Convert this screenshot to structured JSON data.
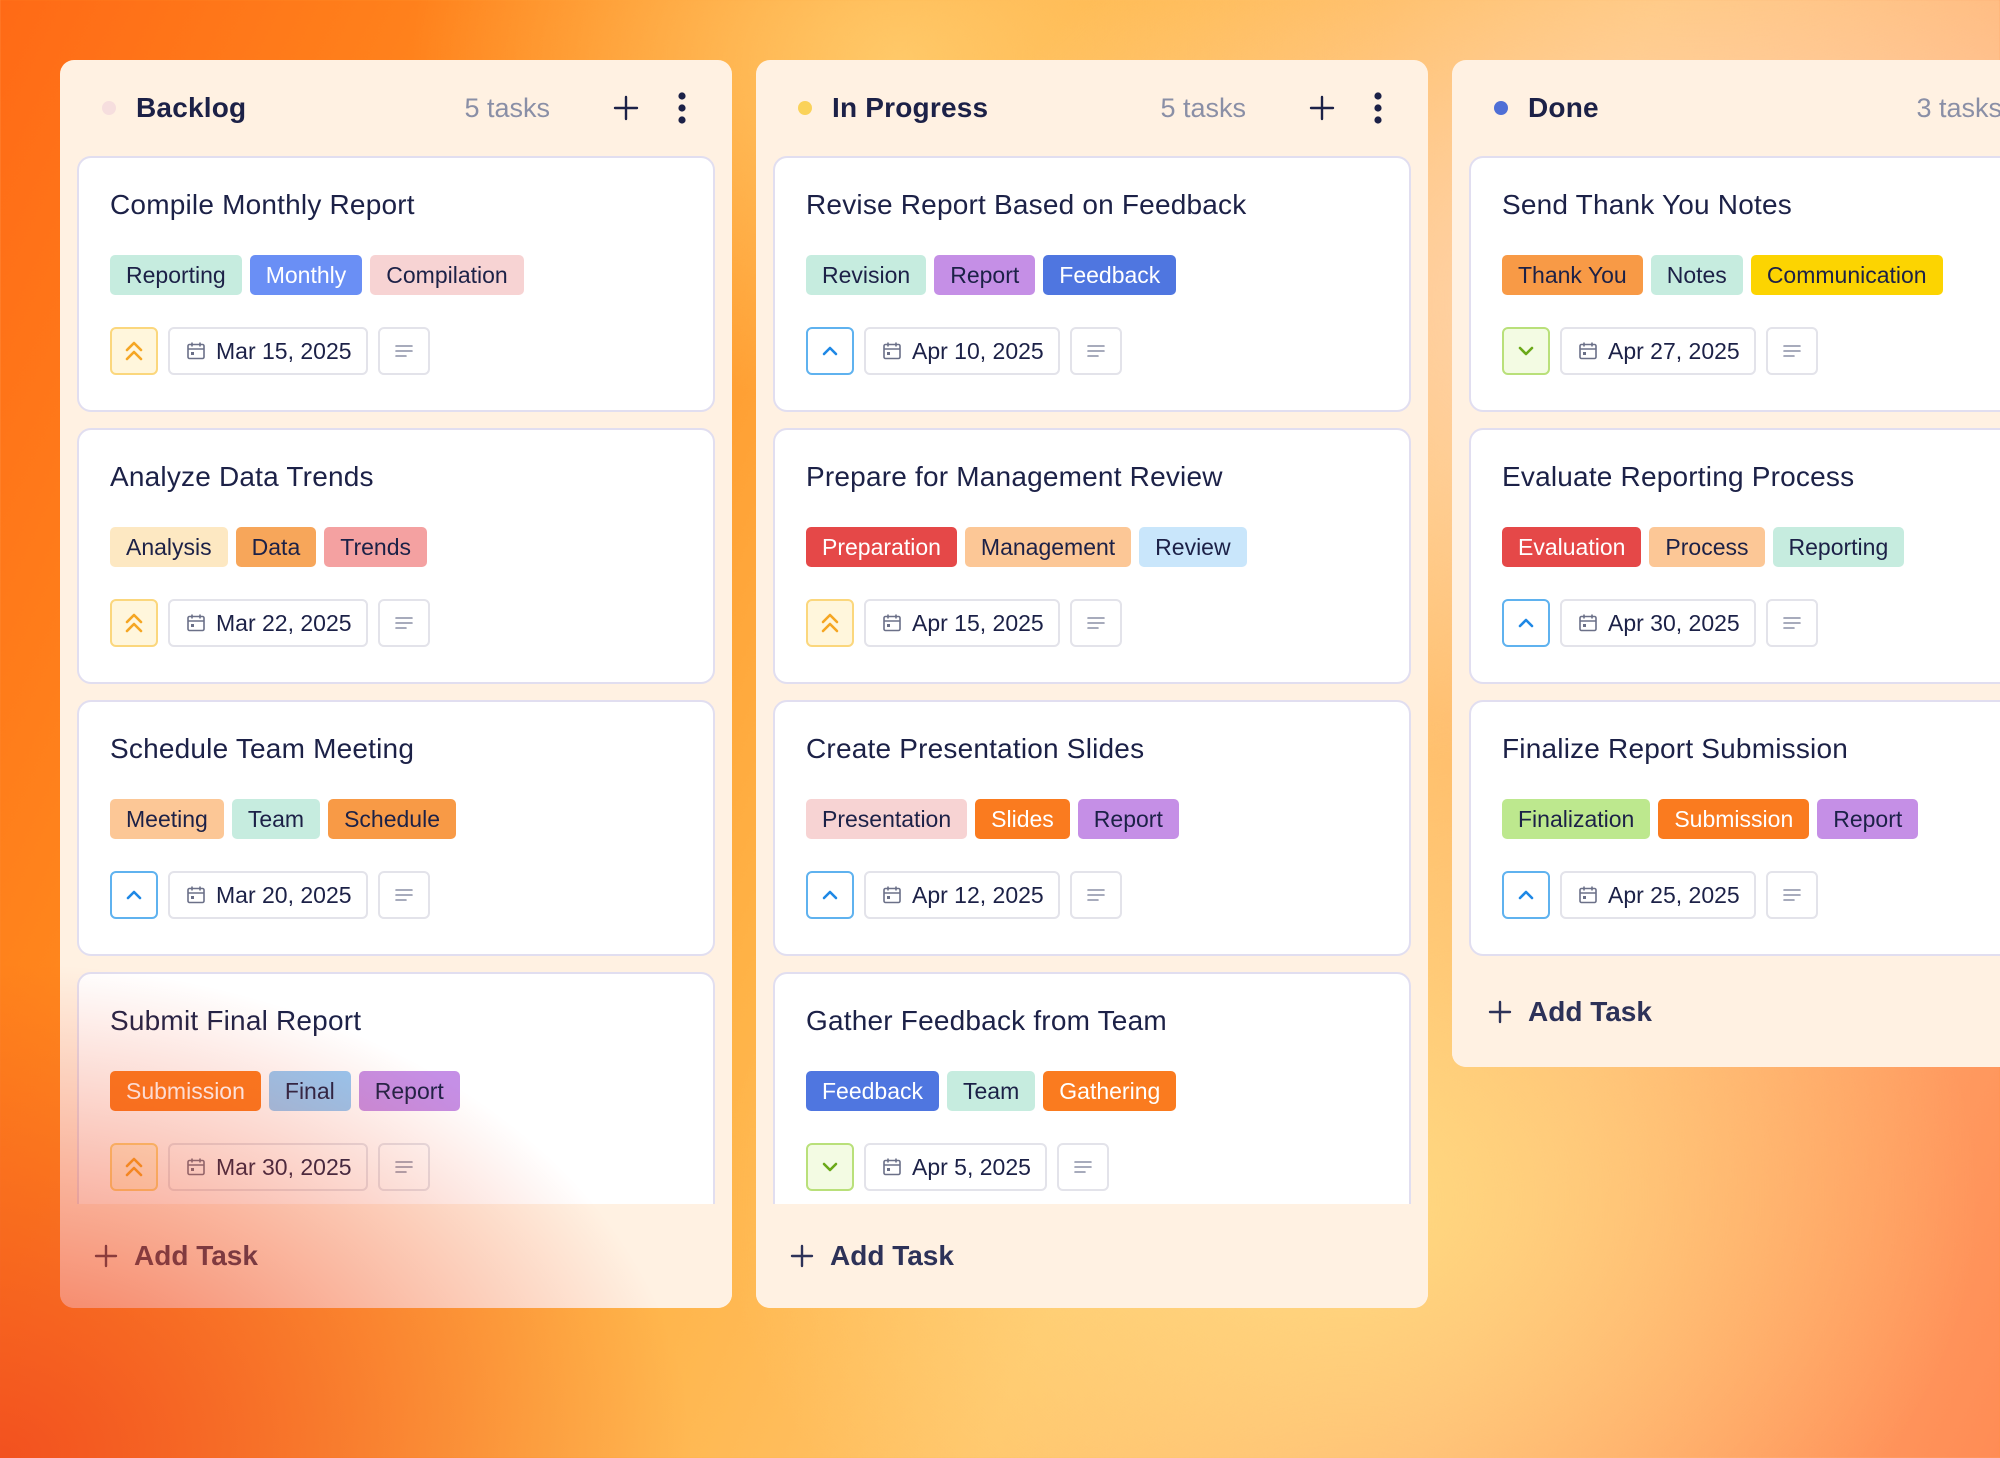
{
  "columns": [
    {
      "id": "backlog",
      "title": "Backlog",
      "count": "5 tasks",
      "dot_color": "#f6dede",
      "add_label": "Add Task",
      "cards": [
        {
          "title": "Compile Monthly Report",
          "tags": [
            {
              "label": "Reporting",
              "bg": "#c6ecdf",
              "fg": "#1c2147"
            },
            {
              "label": "Monthly",
              "bg": "#6a8ff5",
              "fg": "#ffffff"
            },
            {
              "label": "Compilation",
              "bg": "#f7d3d3",
              "fg": "#1c2147"
            }
          ],
          "priority": "urgent",
          "date": "Mar 15, 2025"
        },
        {
          "title": "Analyze Data Trends",
          "tags": [
            {
              "label": "Analysis",
              "bg": "#fde8c2",
              "fg": "#1c2147"
            },
            {
              "label": "Data",
              "bg": "#f7a65a",
              "fg": "#1c2147"
            },
            {
              "label": "Trends",
              "bg": "#f4a1a1",
              "fg": "#1c2147"
            }
          ],
          "priority": "urgent",
          "date": "Mar 22, 2025"
        },
        {
          "title": "Schedule Team Meeting",
          "tags": [
            {
              "label": "Meeting",
              "bg": "#fcc796",
              "fg": "#1c2147"
            },
            {
              "label": "Team",
              "bg": "#c6ecdf",
              "fg": "#1c2147"
            },
            {
              "label": "Schedule",
              "bg": "#f89a46",
              "fg": "#1c2147"
            }
          ],
          "priority": "high",
          "date": "Mar 20, 2025"
        },
        {
          "title": "Submit Final Report",
          "tags": [
            {
              "label": "Submission",
              "bg": "#fa7b1f",
              "fg": "#ffffff"
            },
            {
              "label": "Final",
              "bg": "#94c9f6",
              "fg": "#1c2147"
            },
            {
              "label": "Report",
              "bg": "#c58fe6",
              "fg": "#1c2147"
            }
          ],
          "priority": "urgent",
          "date": "Mar 30, 2025"
        }
      ]
    },
    {
      "id": "progress",
      "title": "In Progress",
      "count": "5 tasks",
      "dot_color": "#fad25a",
      "add_label": "Add Task",
      "cards": [
        {
          "title": "Revise Report Based on Feedback",
          "tags": [
            {
              "label": "Revision",
              "bg": "#c6ecdf",
              "fg": "#1c2147"
            },
            {
              "label": "Report",
              "bg": "#c58fe6",
              "fg": "#1c2147"
            },
            {
              "label": "Feedback",
              "bg": "#4f76e0",
              "fg": "#ffffff"
            }
          ],
          "priority": "high",
          "date": "Apr 10, 2025"
        },
        {
          "title": "Prepare for Management Review",
          "tags": [
            {
              "label": "Preparation",
              "bg": "#e54848",
              "fg": "#ffffff"
            },
            {
              "label": "Management",
              "bg": "#fcc796",
              "fg": "#1c2147"
            },
            {
              "label": "Review",
              "bg": "#c9e6fb",
              "fg": "#1c2147"
            }
          ],
          "priority": "urgent",
          "date": "Apr 15, 2025"
        },
        {
          "title": "Create Presentation Slides",
          "tags": [
            {
              "label": "Presentation",
              "bg": "#f7d3d3",
              "fg": "#1c2147"
            },
            {
              "label": "Slides",
              "bg": "#fa7b1f",
              "fg": "#ffffff"
            },
            {
              "label": "Report",
              "bg": "#c58fe6",
              "fg": "#1c2147"
            }
          ],
          "priority": "high",
          "date": "Apr 12, 2025"
        },
        {
          "title": "Gather Feedback from Team",
          "tags": [
            {
              "label": "Feedback",
              "bg": "#4f76e0",
              "fg": "#ffffff"
            },
            {
              "label": "Team",
              "bg": "#c6ecdf",
              "fg": "#1c2147"
            },
            {
              "label": "Gathering",
              "bg": "#fa7b1f",
              "fg": "#ffffff"
            }
          ],
          "priority": "low",
          "date": "Apr 5, 2025"
        }
      ]
    },
    {
      "id": "done",
      "title": "Done",
      "count": "3 tasks",
      "dot_color": "#4f6fd6",
      "add_label": "Add Task",
      "cards": [
        {
          "title": "Send Thank You Notes",
          "tags": [
            {
              "label": "Thank You",
              "bg": "#f89a46",
              "fg": "#1c2147"
            },
            {
              "label": "Notes",
              "bg": "#c6ecdf",
              "fg": "#1c2147"
            },
            {
              "label": "Communication",
              "bg": "#fcd401",
              "fg": "#1c2147"
            }
          ],
          "priority": "low",
          "date": "Apr 27, 2025"
        },
        {
          "title": "Evaluate Reporting Process",
          "tags": [
            {
              "label": "Evaluation",
              "bg": "#e54848",
              "fg": "#ffffff"
            },
            {
              "label": "Process",
              "bg": "#fcc796",
              "fg": "#1c2147"
            },
            {
              "label": "Reporting",
              "bg": "#c6ecdf",
              "fg": "#1c2147"
            }
          ],
          "priority": "high",
          "date": "Apr 30, 2025"
        },
        {
          "title": "Finalize Report Submission",
          "tags": [
            {
              "label": "Finalization",
              "bg": "#bde88e",
              "fg": "#1c2147"
            },
            {
              "label": "Submission",
              "bg": "#fa7b1f",
              "fg": "#ffffff"
            },
            {
              "label": "Report",
              "bg": "#c58fe6",
              "fg": "#1c2147"
            }
          ],
          "priority": "high",
          "date": "Apr 25, 2025"
        }
      ]
    }
  ],
  "priority_styles": {
    "urgent": {
      "icon": "double-chevron-up-icon",
      "color": "#f5a623",
      "bg": "#fff6dc",
      "border": "#fbd77d"
    },
    "high": {
      "icon": "chevron-up-icon",
      "color": "#1e88e5",
      "bg": "#ffffff",
      "border": "#5fb2ef"
    },
    "low": {
      "icon": "chevron-down-icon",
      "color": "#6aa818",
      "bg": "#f3fbe3",
      "border": "#b9e07a"
    }
  },
  "icons": {
    "add": "plus-icon",
    "menu": "vertical-dots-icon",
    "date": "calendar-icon",
    "description": "text-lines-icon"
  }
}
